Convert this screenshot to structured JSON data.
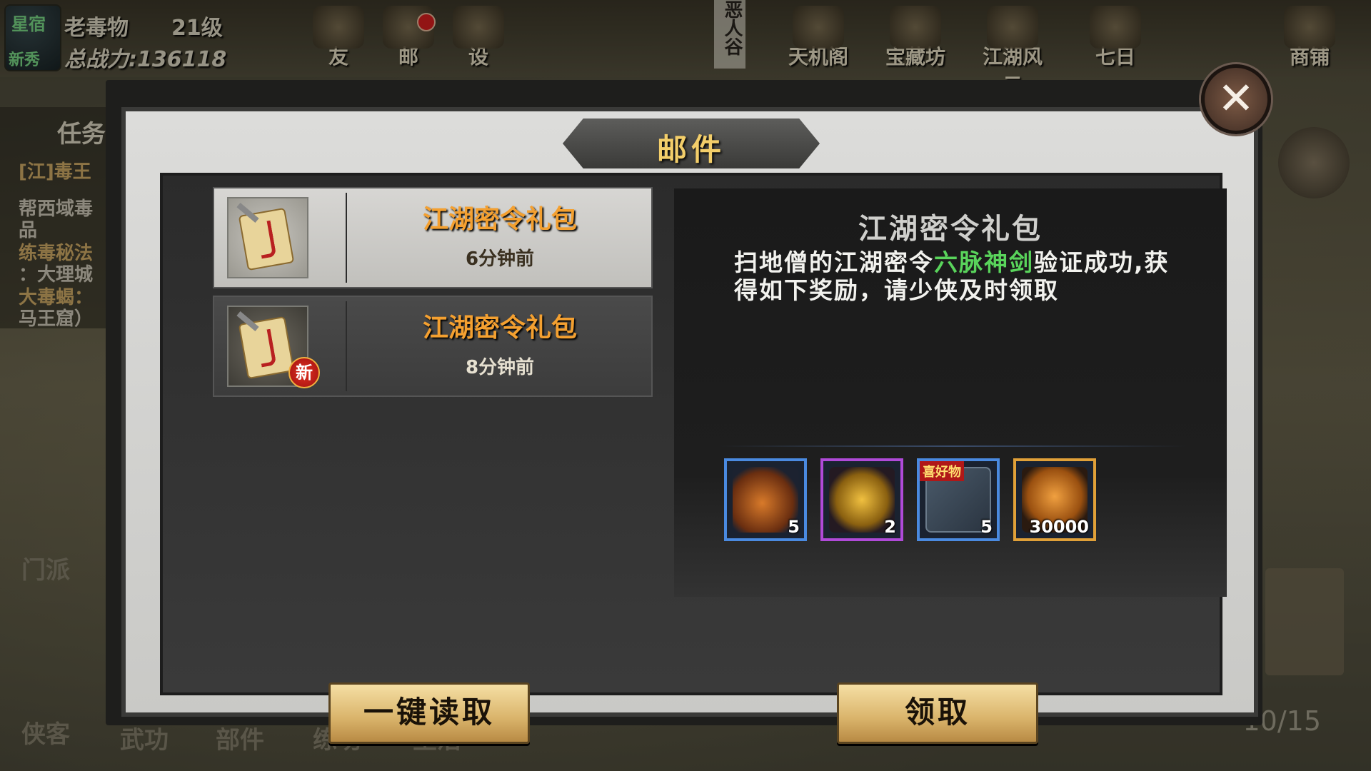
{
  "player": {
    "name": "老毒物",
    "level": "21级",
    "power": "总战力:136118",
    "avatar_title": "星宿",
    "avatar_tag": "新秀"
  },
  "top_icons": [
    {
      "label": "友",
      "icon": "friends-icon"
    },
    {
      "label": "邮",
      "icon": "mail-icon"
    },
    {
      "label": "设",
      "icon": "settings-icon"
    },
    {
      "label": "天机阁",
      "icon": "pavilion-icon"
    },
    {
      "label": "宝藏坊",
      "icon": "treasure-icon"
    },
    {
      "label": "江湖风云",
      "icon": "horn-icon"
    },
    {
      "label": "七日",
      "icon": "scroll-icon"
    },
    {
      "label": "商铺",
      "icon": "shop-icon"
    }
  ],
  "top_banner": "恶人谷",
  "task_panel": {
    "header": "任务",
    "lines": [
      "[江]毒王",
      "帮西域毒",
      "品",
      "练毒秘法",
      "：大理城",
      "大毒蝎：",
      "马王窟）"
    ]
  },
  "bottom_nav": [
    "门派",
    "侠客",
    "武功",
    "部件",
    "练功",
    "生活"
  ],
  "progress_text": "10/15",
  "dialog": {
    "title": "邮件",
    "close_label": "✕",
    "mails": [
      {
        "title": "江湖密令礼包",
        "time": "6分钟前",
        "is_new": false,
        "selected": true
      },
      {
        "title": "江湖密令礼包",
        "time": "8分钟前",
        "is_new": true,
        "new_label": "新",
        "selected": false
      }
    ],
    "detail": {
      "title": "江湖密令礼包",
      "body_before": "扫地僧的江湖密令",
      "body_highlight": "六脉神剑",
      "body_after": "验证成功,获得如下奖励，请少侠及时领取",
      "highlight_color": "#59d45b"
    },
    "rewards": [
      {
        "name": "roast-chicken-icon",
        "count": "5",
        "rarity": "blue"
      },
      {
        "name": "gold-token-icon",
        "count": "2",
        "rarity": "purple"
      },
      {
        "name": "book-icon",
        "count": "5",
        "rarity": "blue",
        "tag": "喜好物"
      },
      {
        "name": "copper-coins-icon",
        "count": "30000",
        "rarity": "gold"
      }
    ],
    "read_all_label": "一键读取",
    "claim_label": "领取"
  }
}
